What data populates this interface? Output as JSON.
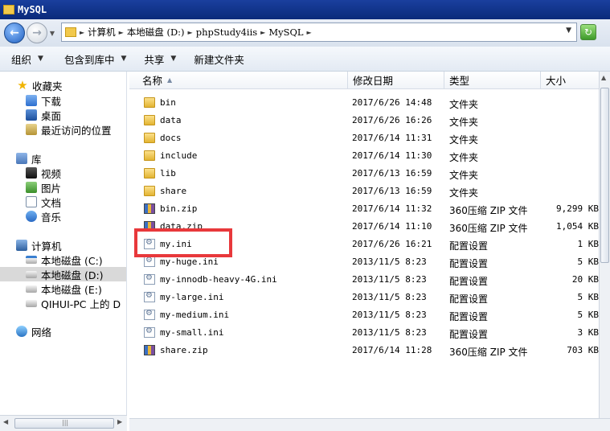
{
  "window": {
    "title": "MySQL"
  },
  "address": {
    "crumbs": [
      "计算机",
      "本地磁盘 (D:)",
      "phpStudy4iis",
      "MySQL"
    ]
  },
  "toolbar": {
    "organize": "组织",
    "include_in_library": "包含到库中",
    "share": "共享",
    "new_folder": "新建文件夹"
  },
  "nav": {
    "favorites": "收藏夹",
    "downloads": "下载",
    "desktop": "桌面",
    "recent": "最近访问的位置",
    "libraries": "库",
    "videos": "视频",
    "pictures": "图片",
    "documents": "文档",
    "music": "音乐",
    "computer": "计算机",
    "drive_c": "本地磁盘 (C:)",
    "drive_d": "本地磁盘 (D:)",
    "drive_e": "本地磁盘 (E:)",
    "network_drive": "QIHUI-PC 上的 D",
    "network": "网络"
  },
  "columns": {
    "name": "名称",
    "date": "修改日期",
    "type": "类型",
    "size": "大小"
  },
  "files": [
    {
      "name": "bin",
      "date": "2017/6/26 14:48",
      "type": "文件夹",
      "size": "",
      "icon": "folder-icon"
    },
    {
      "name": "data",
      "date": "2017/6/26 16:26",
      "type": "文件夹",
      "size": "",
      "icon": "folder-icon"
    },
    {
      "name": "docs",
      "date": "2017/6/14 11:31",
      "type": "文件夹",
      "size": "",
      "icon": "folder-icon"
    },
    {
      "name": "include",
      "date": "2017/6/14 11:30",
      "type": "文件夹",
      "size": "",
      "icon": "folder-icon"
    },
    {
      "name": "lib",
      "date": "2017/6/13 16:59",
      "type": "文件夹",
      "size": "",
      "icon": "folder-icon"
    },
    {
      "name": "share",
      "date": "2017/6/13 16:59",
      "type": "文件夹",
      "size": "",
      "icon": "folder-icon"
    },
    {
      "name": "bin.zip",
      "date": "2017/6/14 11:32",
      "type": "360压缩 ZIP 文件",
      "size": "9,299 KB",
      "icon": "zip-icon"
    },
    {
      "name": "data.zip",
      "date": "2017/6/14 11:10",
      "type": "360压缩 ZIP 文件",
      "size": "1,054 KB",
      "icon": "zip-icon"
    },
    {
      "name": "my.ini",
      "date": "2017/6/26 16:21",
      "type": "配置设置",
      "size": "1 KB",
      "icon": "ini-icon"
    },
    {
      "name": "my-huge.ini",
      "date": "2013/11/5 8:23",
      "type": "配置设置",
      "size": "5 KB",
      "icon": "ini-icon"
    },
    {
      "name": "my-innodb-heavy-4G.ini",
      "date": "2013/11/5 8:23",
      "type": "配置设置",
      "size": "20 KB",
      "icon": "ini-icon"
    },
    {
      "name": "my-large.ini",
      "date": "2013/11/5 8:23",
      "type": "配置设置",
      "size": "5 KB",
      "icon": "ini-icon"
    },
    {
      "name": "my-medium.ini",
      "date": "2013/11/5 8:23",
      "type": "配置设置",
      "size": "5 KB",
      "icon": "ini-icon"
    },
    {
      "name": "my-small.ini",
      "date": "2013/11/5 8:23",
      "type": "配置设置",
      "size": "3 KB",
      "icon": "ini-icon"
    },
    {
      "name": "share.zip",
      "date": "2017/6/14 11:28",
      "type": "360压缩 ZIP 文件",
      "size": "703 KB",
      "icon": "zip-icon"
    }
  ],
  "colors": {
    "title_bar": "#0a2a7a",
    "highlight_box": "#e8383b",
    "selected_nav": "#d9d9d9"
  }
}
